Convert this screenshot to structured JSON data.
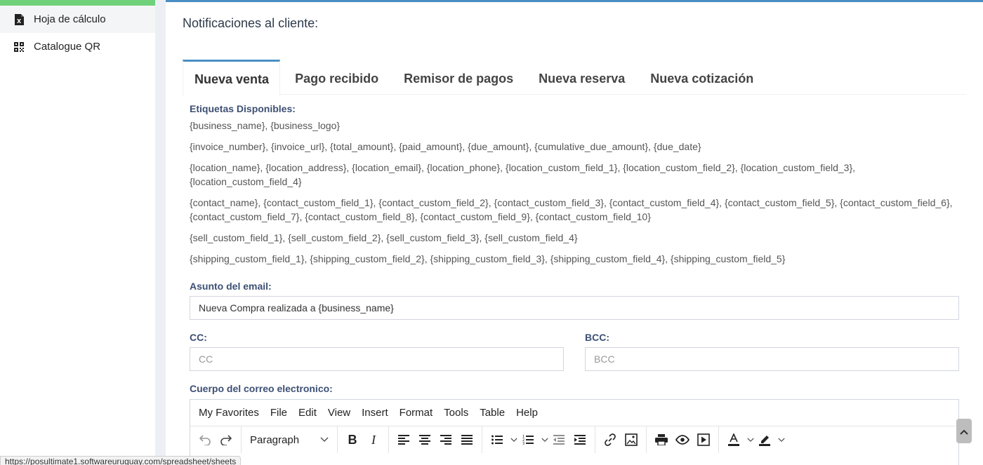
{
  "sidebar": {
    "items": [
      {
        "label": "Hoja de cálculo",
        "icon": "spreadsheet-file-icon"
      },
      {
        "label": "Catalogue QR",
        "icon": "qr-code-icon"
      }
    ],
    "accent": "#6fd17a"
  },
  "card": {
    "title": "Notificaciones al cliente:",
    "accent": "#4a8fc4"
  },
  "tabs": [
    {
      "label": "Nueva venta",
      "active": true
    },
    {
      "label": "Pago recibido"
    },
    {
      "label": "Remisor de pagos"
    },
    {
      "label": "Nueva reserva"
    },
    {
      "label": "Nueva cotización"
    }
  ],
  "tags": {
    "title": "Etiquetas Disponibles:",
    "lines": [
      "{business_name}, {business_logo}",
      "{invoice_number}, {invoice_url}, {total_amount}, {paid_amount}, {due_amount}, {cumulative_due_amount}, {due_date}",
      "{location_name}, {location_address}, {location_email}, {location_phone}, {location_custom_field_1}, {location_custom_field_2}, {location_custom_field_3},",
      "{location_custom_field_4}",
      "{contact_name}, {contact_custom_field_1}, {contact_custom_field_2}, {contact_custom_field_3}, {contact_custom_field_4}, {contact_custom_field_5}, {contact_custom_field_6},",
      "{contact_custom_field_7}, {contact_custom_field_8}, {contact_custom_field_9}, {contact_custom_field_10}",
      "{sell_custom_field_1}, {sell_custom_field_2}, {sell_custom_field_3}, {sell_custom_field_4}",
      "{shipping_custom_field_1}, {shipping_custom_field_2}, {shipping_custom_field_3}, {shipping_custom_field_4}, {shipping_custom_field_5}"
    ]
  },
  "form": {
    "subject_label": "Asunto del email:",
    "subject_value": "Nueva Compra realizada a {business_name}",
    "cc_label": "CC:",
    "cc_placeholder": "CC",
    "bcc_label": "BCC:",
    "bcc_placeholder": "BCC",
    "body_label": "Cuerpo del correo electronico:"
  },
  "editor": {
    "menu": [
      "My Favorites",
      "File",
      "Edit",
      "View",
      "Insert",
      "Format",
      "Tools",
      "Table",
      "Help"
    ],
    "block_format": "Paragraph"
  },
  "status_url": "https://posultimate1.softwareuruguay.com/spreadsheet/sheets"
}
